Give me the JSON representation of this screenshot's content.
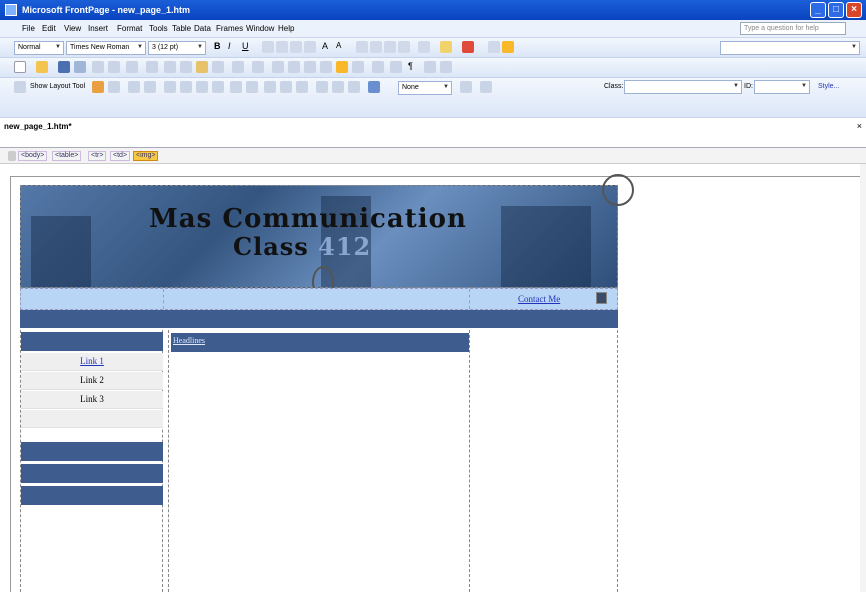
{
  "titlebar": {
    "title": "Microsoft FrontPage - new_page_1.htm"
  },
  "menu": [
    "File",
    "Edit",
    "View",
    "Insert",
    "Format",
    "Tools",
    "Table",
    "Data",
    "Frames",
    "Window",
    "Help"
  ],
  "help_placeholder": "Type a question for help",
  "formatting": {
    "style": "Normal",
    "font": "Times New Roman",
    "size": "3 (12 pt)"
  },
  "tables_toolbar": {
    "layout_tool": "Show Layout Tool",
    "none_label": "None"
  },
  "style_toolbar": {
    "class_label": "Class:",
    "id_label": "ID:",
    "style_label": "Style..."
  },
  "document": {
    "tab_name": "new_page_1.htm*"
  },
  "tag_selector": [
    "<body>",
    "<table>",
    "<tr>",
    "<td>",
    "<img>"
  ],
  "banner": {
    "line1": "Mas Communication",
    "line2_word": "Class",
    "line2_num": "412"
  },
  "nav": {
    "contact": "Contact Me"
  },
  "links": [
    "Link 1",
    "Link 2",
    "Link 3"
  ],
  "headlines": "Headlines",
  "colors": {
    "title_blue": "#0a43c0",
    "banner_blue": "#3e5d8e",
    "nav_blue": "#b9d5f5",
    "tag_selected": "#f8c844"
  }
}
